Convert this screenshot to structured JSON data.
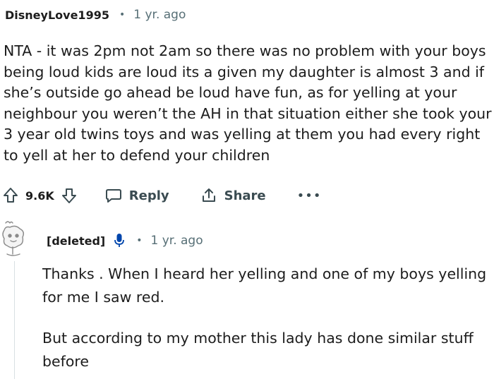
{
  "comment": {
    "username": "DisneyLove1995",
    "separator": "•",
    "age": "1 yr. ago",
    "body": "NTA - it was 2pm not 2am so there was no problem with your boys being loud kids are loud its a given my daughter is almost 3 and if she’s outside go ahead be loud have fun, as for yelling at your neighbour you weren’t the AH in that situation either she took your 3 year old twins toys and was yelling at them you had every right to yell at her to defend your children",
    "actions": {
      "score": "9.6K",
      "reply_label": "Reply",
      "share_label": "Share",
      "more_label": "•••"
    }
  },
  "reply": {
    "username": "[deleted]",
    "separator": "•",
    "age": "1 yr. ago",
    "paragraphs": [
      "Thanks . When I heard her yelling and one of my boys yelling for me I saw red.",
      "But according to my mother this lady has done similar stuff before"
    ]
  },
  "colors": {
    "text": "#1c1c1c",
    "meta": "#576f76",
    "action": "#3a4b51",
    "mic": "#0045ac",
    "thread_line": "#d8dfe2"
  }
}
